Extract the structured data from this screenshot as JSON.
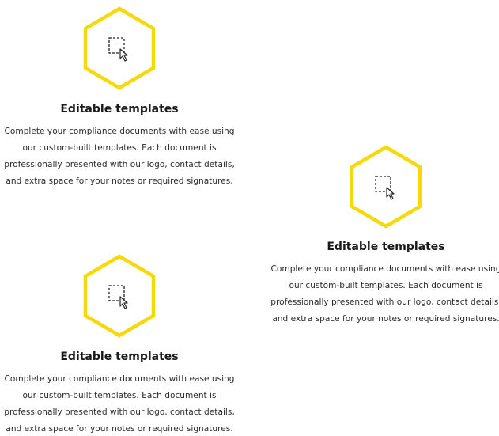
{
  "colors": {
    "accent": "#f5d90a",
    "text": "#222222"
  },
  "features": [
    {
      "icon": "edit-selection-icon",
      "title": "Editable templates",
      "lines": [
        "Complete your compliance documents with ease using",
        "our custom-built templates. Each document is",
        "professionally presented with our logo, contact details,",
        "and extra space for your notes or required signatures."
      ]
    },
    {
      "icon": "edit-selection-icon",
      "title": "Editable templates",
      "lines": [
        "Complete your compliance documents with ease using",
        "our custom-built templates. Each document is",
        "professionally presented with our logo, contact details,",
        "and extra space for your notes or required signatures."
      ]
    },
    {
      "icon": "edit-selection-icon",
      "title": "Editable templates",
      "lines": [
        "Complete your compliance documents with ease using",
        "our custom-built templates. Each document is",
        "professionally presented with our logo, contact details,",
        "and extra space for your notes or required signatures."
      ]
    }
  ]
}
